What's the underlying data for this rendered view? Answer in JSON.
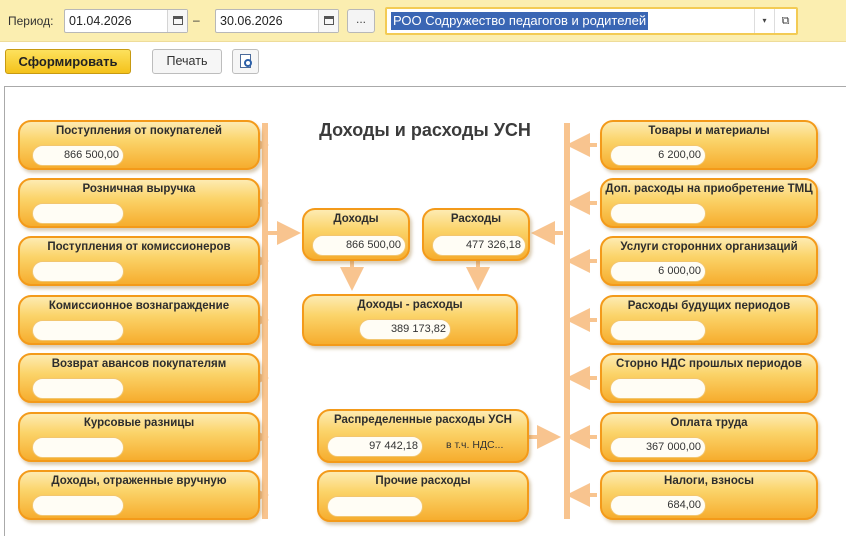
{
  "toolbar": {
    "period_label": "Период:",
    "date_from": "01.04.2026",
    "dash": "–",
    "date_to": "30.06.2026",
    "dots_label": "...",
    "organization": "РОО Содружество педагогов и родителей",
    "dropdown_glyph": "▾",
    "open_glyph": "⧉",
    "generate_label": "Сформировать",
    "print_label": "Печать"
  },
  "report": {
    "title": "Доходы и расходы УСН",
    "left_cards": [
      {
        "title": "Поступления от покупателей",
        "value": "866 500,00"
      },
      {
        "title": "Розничная выручка",
        "value": ""
      },
      {
        "title": "Поступления от комиссионеров",
        "value": ""
      },
      {
        "title": "Комиссионное вознаграждение",
        "value": ""
      },
      {
        "title": "Возврат авансов покупателям",
        "value": ""
      },
      {
        "title": "Курсовые разницы",
        "value": ""
      },
      {
        "title": "Доходы, отраженные вручную",
        "value": ""
      }
    ],
    "right_cards": [
      {
        "title": "Товары и материалы",
        "value": "6 200,00"
      },
      {
        "title": "Доп. расходы на приобретение ТМЦ",
        "value": ""
      },
      {
        "title": "Услуги сторонних организаций",
        "value": "6 000,00"
      },
      {
        "title": "Расходы будущих периодов",
        "value": ""
      },
      {
        "title": "Сторно НДС прошлых периодов",
        "value": ""
      },
      {
        "title": "Оплата труда",
        "value": "367 000,00"
      },
      {
        "title": "Налоги, взносы",
        "value": "684,00"
      }
    ],
    "income": {
      "title": "Доходы",
      "value": "866 500,00"
    },
    "expenses": {
      "title": "Расходы",
      "value": "477 326,18"
    },
    "difference": {
      "title": "Доходы - расходы",
      "value": "389 173,82"
    },
    "distributed": {
      "title": "Распределенные расходы УСН",
      "value": "97 442,18",
      "vat_note": "в т.ч. НДС..."
    },
    "other": {
      "title": "Прочие расходы",
      "value": ""
    }
  },
  "colors": {
    "toolbar_bg": "#fbeeb0",
    "card_border": "#f39a1a",
    "arrow": "#f8c48f",
    "selection": "#3a66b4",
    "generate_button": "#f4c21b"
  }
}
